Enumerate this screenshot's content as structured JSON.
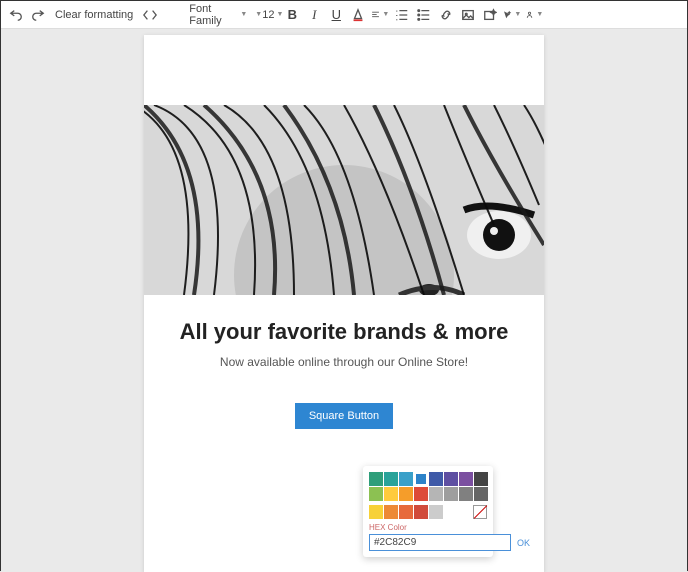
{
  "toolbar": {
    "clear_formatting": "Clear formatting",
    "font_family": "Font Family",
    "font_size": "12",
    "bold": "B",
    "italic": "I",
    "underline": "U"
  },
  "content": {
    "headline": "All your favorite brands & more",
    "subhead": "Now available online through our Online Store!",
    "button_label": "Square Button"
  },
  "color_picker": {
    "rows": [
      [
        "#2e9e7a",
        "#29a39a",
        "#3aa0c9",
        "#2c82c9",
        "#3f5aa8",
        "#5e4fa2",
        "#7b4fa0",
        "#444444"
      ],
      [
        "#8cc152",
        "#ffcb3d",
        "#f59d2a",
        "#dd4b39",
        "#b5b5b5",
        "#9e9e9e",
        "#808080",
        "#666666"
      ],
      [
        "#f7d138",
        "#ed8936",
        "#e76a3b",
        "#d14b3b",
        "#cccccc",
        "#ffffff",
        "",
        ""
      ]
    ],
    "selected_index": [
      0,
      3
    ],
    "hex_label": "HEX Color",
    "hex_value": "#2C82C9",
    "ok_label": "OK"
  }
}
